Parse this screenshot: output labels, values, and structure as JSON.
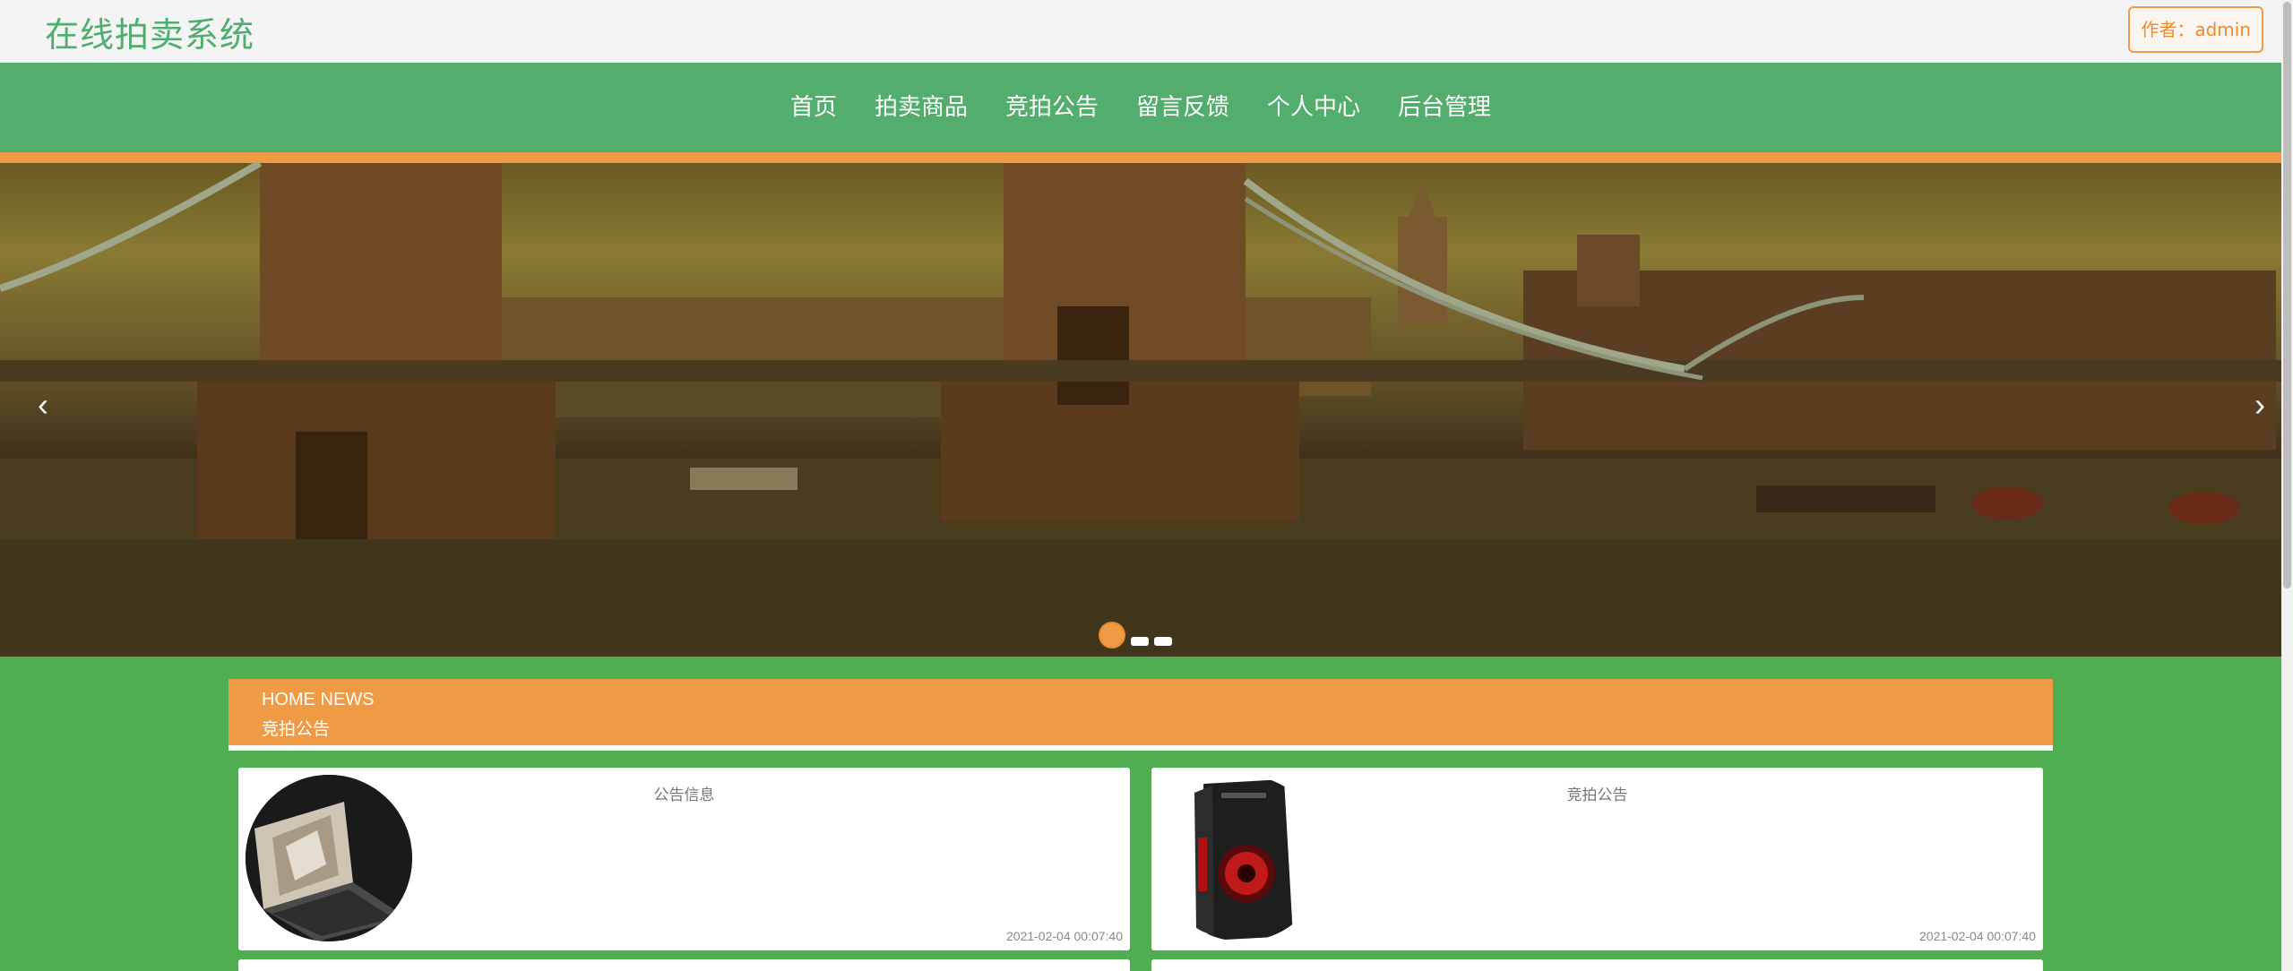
{
  "header": {
    "site_title": "在线拍卖系统",
    "author_label": "作者：admin"
  },
  "nav": {
    "items": [
      {
        "label": "首页"
      },
      {
        "label": "拍卖商品"
      },
      {
        "label": "竞拍公告"
      },
      {
        "label": "留言反馈"
      },
      {
        "label": "个人中心"
      },
      {
        "label": "后台管理"
      }
    ]
  },
  "banner": {
    "prev_icon": "chevron-left-icon",
    "next_icon": "chevron-right-icon",
    "slide_count": 3,
    "active_slide": 1
  },
  "news": {
    "title_en": "HOME NEWS",
    "title_cn": "竞拍公告",
    "cards": [
      {
        "title": "公告信息",
        "date": "2021-02-04 00:07:40",
        "image": "laptop"
      },
      {
        "title": "竞拍公告",
        "date": "2021-02-04 00:07:40",
        "image": "pc-tower"
      }
    ]
  },
  "colors": {
    "brand_green": "#4fae6f",
    "nav_green": "#53ae6e",
    "main_green": "#4fae52",
    "accent_orange": "#ef9a45"
  }
}
